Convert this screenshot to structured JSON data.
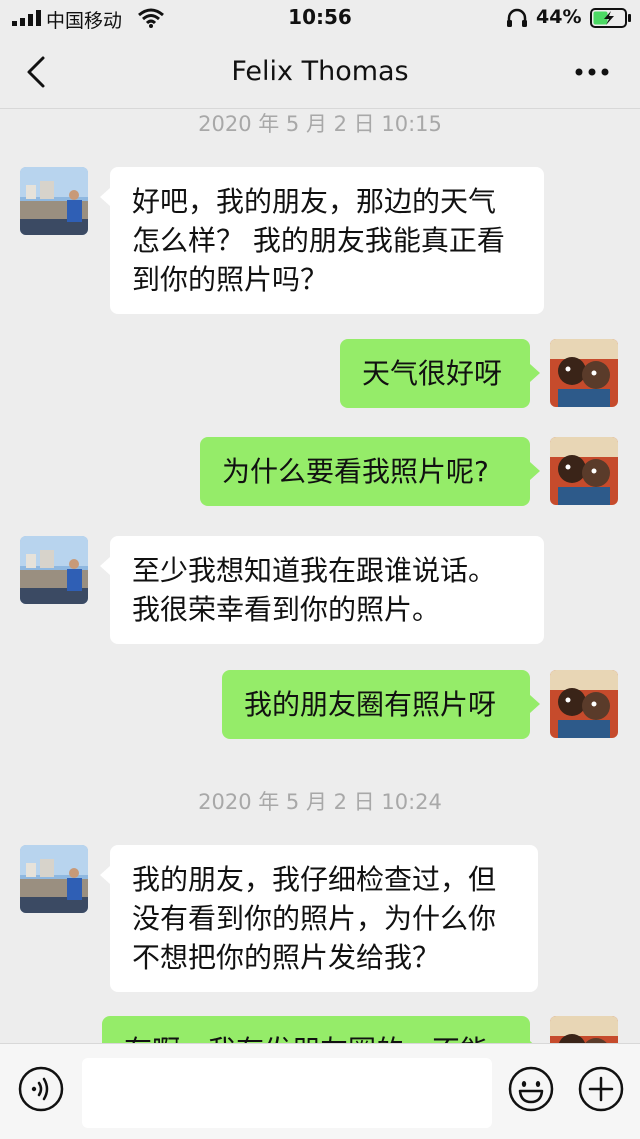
{
  "status_bar": {
    "carrier": "中国移动",
    "time": "10:56",
    "battery": "44%"
  },
  "nav": {
    "title": "Felix Thomas"
  },
  "chat": {
    "timestamps": [
      "2020 年 5 月 2 日 10:15",
      "2020 年 5 月 2 日 10:24"
    ],
    "messages": [
      {
        "from": "contact",
        "text": "好吧，我的朋友，那边的天气怎么样？ 我的朋友我能真正看到你的照片吗？"
      },
      {
        "from": "me",
        "text": "天气很好呀"
      },
      {
        "from": "me",
        "text": "为什么要看我照片呢?"
      },
      {
        "from": "contact",
        "text": "至少我想知道我在跟谁说话。我很荣幸看到你的照片。"
      },
      {
        "from": "me",
        "text": "我的朋友圈有照片呀"
      },
      {
        "from": "contact",
        "text": "我的朋友，我仔细检查过，但没有看到你的照片，为什么你不想把你的照片发给我？"
      },
      {
        "from": "me",
        "text": "有啊，我有发朋友圈的，不能"
      }
    ]
  },
  "input": {
    "placeholder": ""
  },
  "colors": {
    "background": "#ededed",
    "incoming_bubble": "#ffffff",
    "outgoing_bubble": "#95ec69",
    "timestamp": "#a8a8a8"
  }
}
